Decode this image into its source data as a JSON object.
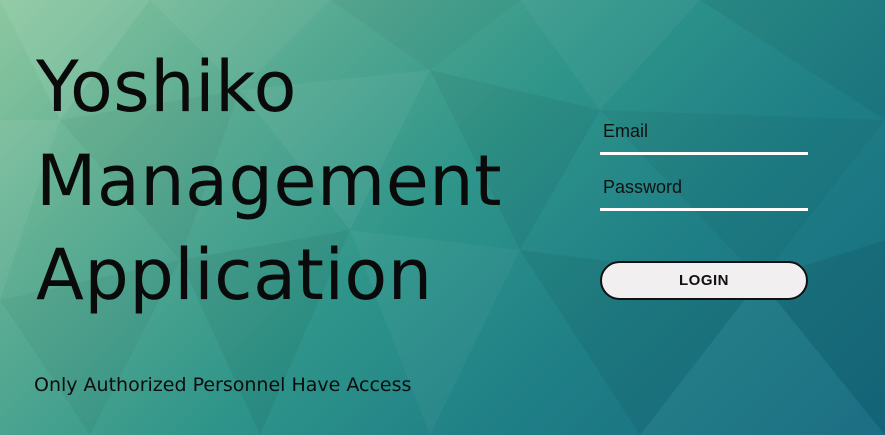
{
  "header": {
    "title_lines": [
      "Yoshiko",
      "Management",
      "Application"
    ],
    "subtitle": "Only Authorized Personnel Have Access"
  },
  "login_form": {
    "email_placeholder": "Email",
    "password_placeholder": "Password",
    "login_label": "LOGIN"
  },
  "colors": {
    "gradient_start": "#8cc8a0",
    "gradient_mid": "#2f958a",
    "gradient_end": "#156a80",
    "input_underline": "#ffffff",
    "button_bg": "#f1eff0"
  }
}
